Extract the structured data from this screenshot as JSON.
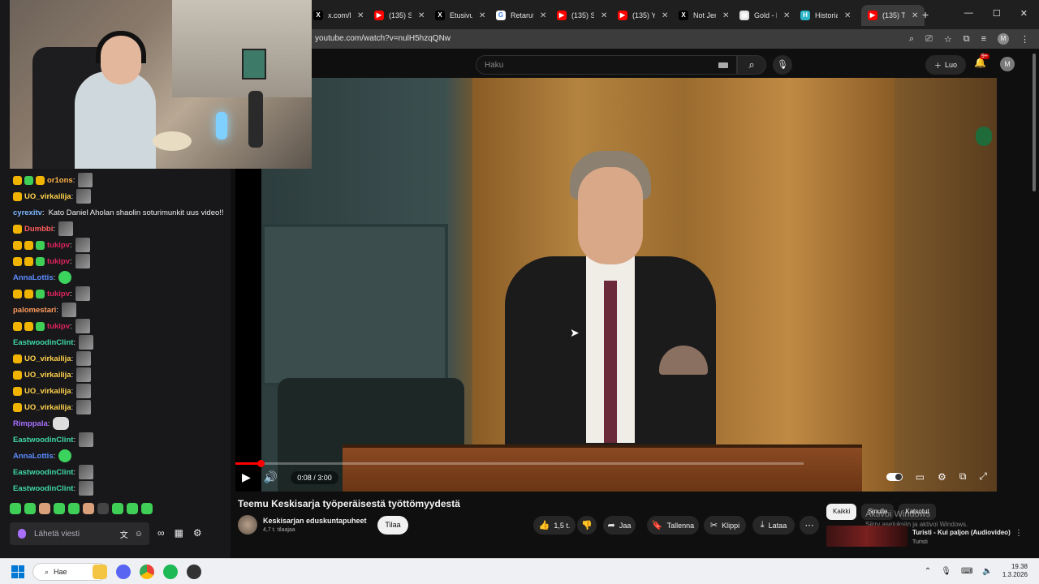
{
  "browser": {
    "tabs": [
      {
        "icon": "x-logo-icon",
        "label": "x.com/l"
      },
      {
        "icon": "youtube-icon",
        "label": "(135) S"
      },
      {
        "icon": "x-logo-icon",
        "label": "Etusivu"
      },
      {
        "icon": "google-icon",
        "label": "Retarut"
      },
      {
        "icon": "youtube-icon",
        "label": "(135) S"
      },
      {
        "icon": "youtube-icon",
        "label": "(135) Y"
      },
      {
        "icon": "x-logo-icon",
        "label": "Not Jer"
      },
      {
        "icon": "page-icon",
        "label": "Gold - l"
      },
      {
        "icon": "history-icon",
        "label": "Historia"
      },
      {
        "icon": "youtube-icon",
        "label": "(135) T"
      }
    ],
    "url": "youtube.com/watch?v=nulH5hzqQNw"
  },
  "youtube": {
    "search_placeholder": "Haku",
    "create_label": "Luo",
    "notification_count": "9+",
    "avatar_letter": "M",
    "video": {
      "time": "0:08 / 3:00",
      "progress_fraction": 0.044,
      "title": "Teemu Keskisarja työperäisestä työttömyydestä",
      "channel": "Keskisarjan eduskuntapuheet",
      "subscribers": "4,7 t. tilaajaa",
      "subscribe_label": "Tilaa",
      "likes": "1,5 t.",
      "share_label": "Jaa",
      "save_label": "Tallenna",
      "clip_label": "Klippi",
      "download_label": "Lataa"
    },
    "filters": [
      "Kaikki",
      "Sinulle",
      "Katsotut"
    ],
    "recommendation": {
      "title": "Turisti - Kui paljon (Audiovideo)",
      "channel": "Turisti"
    },
    "activate_windows": {
      "title": "Aktivoi Windows",
      "subtitle": "Siirry asetuksiin ja aktivoi Windows."
    }
  },
  "chat": {
    "messages": [
      {
        "user": "or1ons",
        "color": "#ffb347",
        "badges": [
          "#f0b400",
          "#3fcf56",
          "#f0b400"
        ],
        "text": "",
        "emote": "face"
      },
      {
        "user": "UO_virkailija",
        "color": "#ffd24a",
        "badges": [
          "#f0b400"
        ],
        "text": "",
        "emote": "face"
      },
      {
        "user": "cyrexitv",
        "color": "#7db7ff",
        "badges": [],
        "text": "Kato Daniel Aholan shaolin soturimunkit uus video!!",
        "emote": ""
      },
      {
        "user": "Dumbbi",
        "color": "#ff5c5c",
        "badges": [
          "#f0b400"
        ],
        "text": "",
        "emote": "face"
      },
      {
        "user": "tukipv",
        "color": "#e0245e",
        "badges": [
          "#f0b400",
          "#f0b400",
          "#3fcf56"
        ],
        "text": "",
        "emote": "face"
      },
      {
        "user": "tukipv",
        "color": "#e0245e",
        "badges": [
          "#f0b400",
          "#f0b400",
          "#3fcf56"
        ],
        "text": "",
        "emote": "face"
      },
      {
        "user": "AnnaLottis",
        "color": "#5b8cff",
        "badges": [],
        "text": "",
        "emote": "green"
      },
      {
        "user": "tukipv",
        "color": "#e0245e",
        "badges": [
          "#f0b400",
          "#f0b400",
          "#3fcf56"
        ],
        "text": "",
        "emote": "face"
      },
      {
        "user": "palomestari",
        "color": "#ff9a5b",
        "badges": [],
        "text": "",
        "emote": "face"
      },
      {
        "user": "tukipv",
        "color": "#e0245e",
        "badges": [
          "#f0b400",
          "#f0b400",
          "#3fcf56"
        ],
        "text": "",
        "emote": "face"
      },
      {
        "user": "EastwoodinClint",
        "color": "#3fd6a6",
        "badges": [],
        "text": "",
        "emote": "face"
      },
      {
        "user": "UO_virkailija",
        "color": "#ffd24a",
        "badges": [
          "#f0b400"
        ],
        "text": "",
        "emote": "face"
      },
      {
        "user": "UO_virkailija",
        "color": "#ffd24a",
        "badges": [
          "#f0b400"
        ],
        "text": "",
        "emote": "face"
      },
      {
        "user": "UO_virkailija",
        "color": "#ffd24a",
        "badges": [
          "#f0b400"
        ],
        "text": "",
        "emote": "face"
      },
      {
        "user": "UO_virkailija",
        "color": "#ffd24a",
        "badges": [
          "#f0b400"
        ],
        "text": "",
        "emote": "face"
      },
      {
        "user": "Rimppala",
        "color": "#a970ff",
        "badges": [],
        "text": "",
        "emote": "cat"
      },
      {
        "user": "EastwoodinClint",
        "color": "#3fd6a6",
        "badges": [],
        "text": "",
        "emote": "face"
      },
      {
        "user": "AnnaLottis",
        "color": "#5b8cff",
        "badges": [],
        "text": "",
        "emote": "green"
      },
      {
        "user": "EastwoodinClint",
        "color": "#3fd6a6",
        "badges": [],
        "text": "",
        "emote": "face"
      },
      {
        "user": "EastwoodinClint",
        "color": "#3fd6a6",
        "badges": [],
        "text": "",
        "emote": "face"
      }
    ],
    "input_placeholder": "Lähetä viesti"
  },
  "taskbar": {
    "search_label": "Hae",
    "time": "19.38",
    "date": "1.3.2026"
  },
  "colors": {
    "accent_red": "#ff0000",
    "twitch_purple": "#a970ff"
  }
}
